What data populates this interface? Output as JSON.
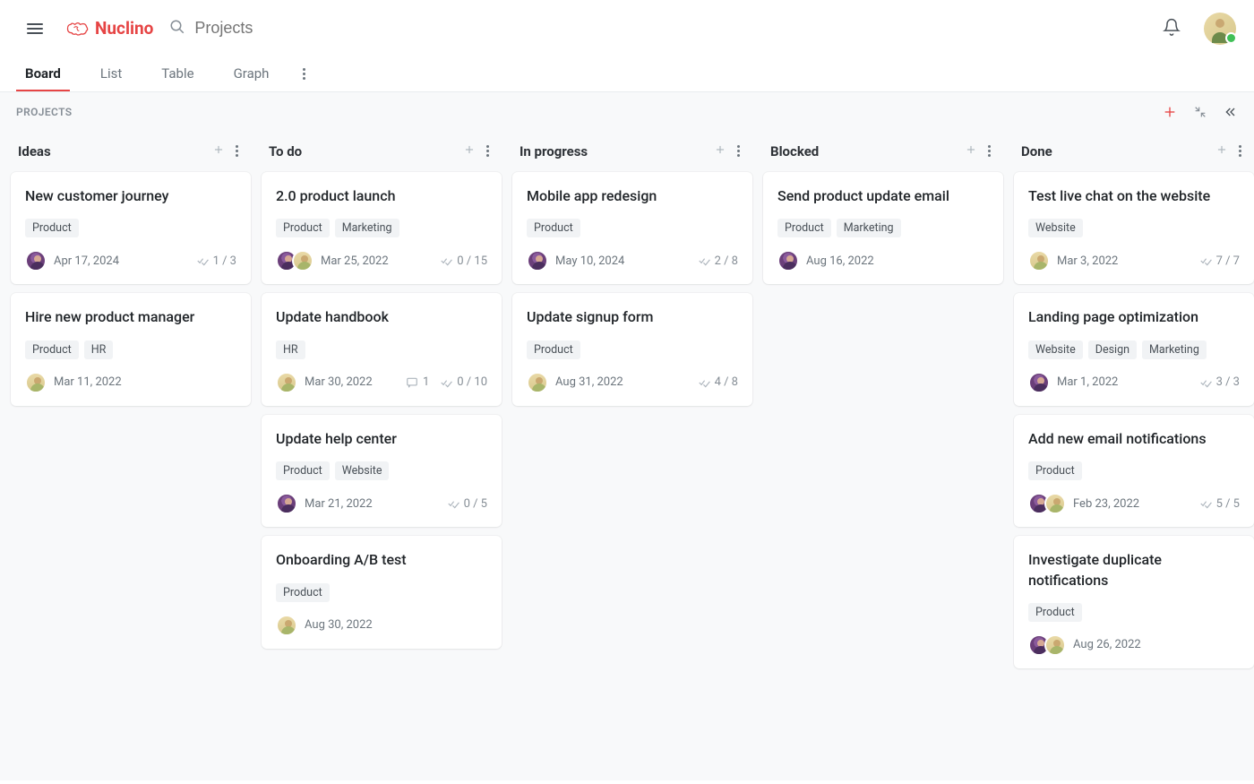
{
  "brand": "Nuclino",
  "search_placeholder": "Projects",
  "tabs": [
    "Board",
    "List",
    "Table",
    "Graph"
  ],
  "active_tab": 0,
  "section_title": "PROJECTS",
  "columns": [
    {
      "title": "Ideas",
      "cards": [
        {
          "title": "New customer journey",
          "tags": [
            "Product"
          ],
          "avatars": [
            "a1"
          ],
          "date": "Apr 17, 2024",
          "checks": "1 / 3",
          "comments": null
        },
        {
          "title": "Hire new product manager",
          "tags": [
            "Product",
            "HR"
          ],
          "avatars": [
            "a2"
          ],
          "date": "Mar 11, 2022",
          "checks": null,
          "comments": null
        }
      ]
    },
    {
      "title": "To do",
      "cards": [
        {
          "title": "2.0 product launch",
          "tags": [
            "Product",
            "Marketing"
          ],
          "avatars": [
            "a1",
            "a2"
          ],
          "date": "Mar 25, 2022",
          "checks": "0 / 15",
          "comments": null
        },
        {
          "title": "Update handbook",
          "tags": [
            "HR"
          ],
          "avatars": [
            "a2"
          ],
          "date": "Mar 30, 2022",
          "checks": "0 / 10",
          "comments": "1"
        },
        {
          "title": "Update help center",
          "tags": [
            "Product",
            "Website"
          ],
          "avatars": [
            "a1"
          ],
          "date": "Mar 21, 2022",
          "checks": "0 / 5",
          "comments": null
        },
        {
          "title": "Onboarding A/B test",
          "tags": [
            "Product"
          ],
          "avatars": [
            "a2"
          ],
          "date": "Aug 30, 2022",
          "checks": null,
          "comments": null
        }
      ]
    },
    {
      "title": "In progress",
      "cards": [
        {
          "title": "Mobile app redesign",
          "tags": [
            "Product"
          ],
          "avatars": [
            "a1"
          ],
          "date": "May 10, 2024",
          "checks": "2 / 8",
          "comments": null
        },
        {
          "title": "Update signup form",
          "tags": [
            "Product"
          ],
          "avatars": [
            "a2"
          ],
          "date": "Aug 31, 2022",
          "checks": "4 / 8",
          "comments": null
        }
      ]
    },
    {
      "title": "Blocked",
      "cards": [
        {
          "title": "Send product update email",
          "tags": [
            "Product",
            "Marketing"
          ],
          "avatars": [
            "a1"
          ],
          "date": "Aug 16, 2022",
          "checks": null,
          "comments": null
        }
      ]
    },
    {
      "title": "Done",
      "cards": [
        {
          "title": "Test live chat on the website",
          "tags": [
            "Website"
          ],
          "avatars": [
            "a2"
          ],
          "date": "Mar 3, 2022",
          "checks": "7 / 7",
          "comments": null
        },
        {
          "title": "Landing page optimization",
          "tags": [
            "Website",
            "Design",
            "Marketing"
          ],
          "avatars": [
            "a1"
          ],
          "date": "Mar 1, 2022",
          "checks": "3 / 3",
          "comments": null
        },
        {
          "title": "Add new email notifications",
          "tags": [
            "Product"
          ],
          "avatars": [
            "a1",
            "a2"
          ],
          "date": "Feb 23, 2022",
          "checks": "5 / 5",
          "comments": null
        },
        {
          "title": "Investigate duplicate notifications",
          "tags": [
            "Product"
          ],
          "avatars": [
            "a1",
            "a2"
          ],
          "date": "Aug 26, 2022",
          "checks": null,
          "comments": null
        }
      ]
    }
  ]
}
